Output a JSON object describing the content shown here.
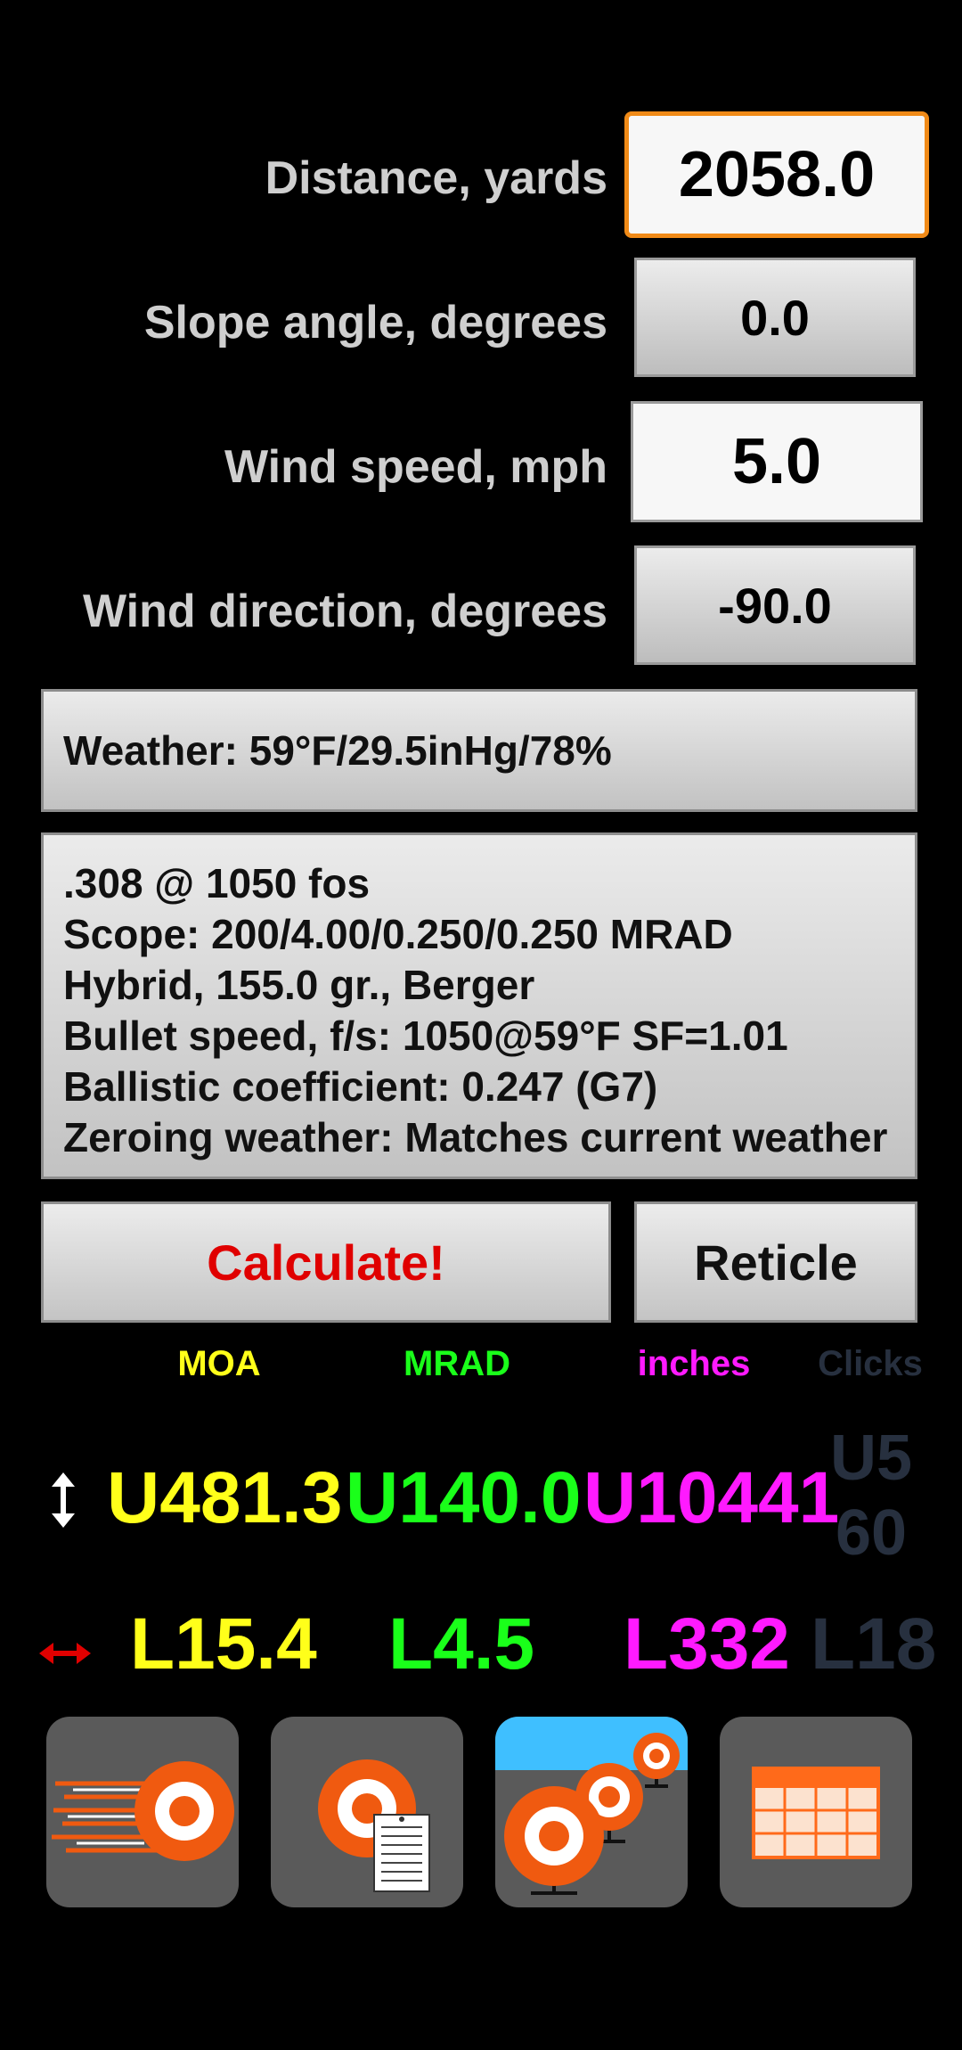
{
  "inputs": {
    "distance": {
      "label": "Distance, yards",
      "value": "2058.0"
    },
    "slope": {
      "label": "Slope angle, degrees",
      "value": "0.0"
    },
    "wind_speed": {
      "label": "Wind speed, mph",
      "value": "5.0"
    },
    "wind_direction": {
      "label": "Wind direction, degrees",
      "value": "-90.0"
    }
  },
  "weather": "Weather: 59°F/29.5inHg/78%",
  "profile": {
    "line1": ".308 @ 1050 fos",
    "line2": "Scope: 200/4.00/0.250/0.250 MRAD",
    "line3": "Hybrid, 155.0 gr., Berger",
    "line4": "Bullet speed, f/s: 1050@59°F SF=1.01",
    "line5": "Ballistic coefficient: 0.247 (G7)",
    "line6": "Zeroing weather: Matches current weather"
  },
  "buttons": {
    "calculate": "Calculate!",
    "reticle": "Reticle"
  },
  "units": {
    "moa": "MOA",
    "mrad": "MRAD",
    "inches": "inches",
    "clicks": "Clicks"
  },
  "elevation": {
    "moa": "U481.3",
    "mrad": "U140.0",
    "inches": "U10441",
    "clicks_line1": "U5",
    "clicks_line2": "60"
  },
  "windage": {
    "moa": "L15.4",
    "mrad": "L4.5",
    "inches": "L332",
    "clicks": "L18"
  },
  "colors": {
    "moa": "#ffff1a",
    "mrad": "#1aff1a",
    "inches": "#ff1aff",
    "clicks": "#27303f",
    "calculate": "#e00000",
    "accent": "#f08a17"
  },
  "icons": [
    "speed-target-icon",
    "target-document-icon",
    "multi-target-range-icon",
    "table-grid-icon"
  ]
}
